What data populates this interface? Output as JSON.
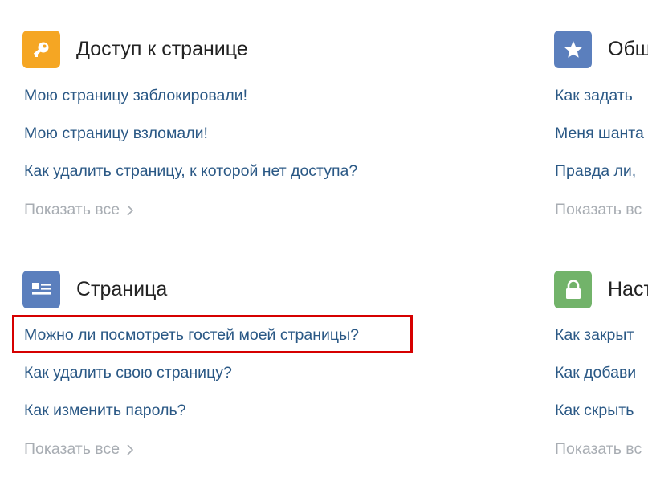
{
  "colors": {
    "orange": "#f5a623",
    "blue": "#5b7fbd",
    "green": "#72b36a",
    "link": "#2a5885",
    "muted": "#a8adb3",
    "highlight": "#d60000"
  },
  "sections": {
    "access": {
      "icon": "key-icon",
      "title": "Доступ к странице",
      "links": [
        "Мою страницу заблокировали!",
        "Мою страницу взломали!",
        "Как удалить страницу, к которой нет доступа?"
      ],
      "show_all": "Показать все"
    },
    "page": {
      "icon": "page-icon",
      "title": "Страница",
      "links": [
        "Можно ли посмотреть гостей моей страницы?",
        "Как удалить свою страницу?",
        "Как изменить пароль?"
      ],
      "show_all": "Показать все"
    },
    "general": {
      "icon": "star-icon",
      "title": "Общ",
      "links": [
        "Как задать",
        "Меня шанта",
        "Правда ли,"
      ],
      "show_all": "Показать вс"
    },
    "settings": {
      "icon": "lock-icon",
      "title": "Наст",
      "links": [
        "Как закрыт",
        "Как добави",
        "Как скрыть"
      ],
      "show_all": "Показать вс"
    }
  }
}
